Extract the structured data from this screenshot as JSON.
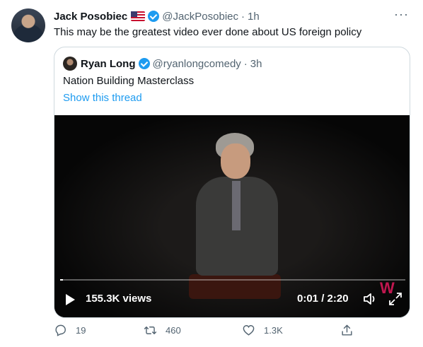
{
  "tweet": {
    "author_name": "Jack Posobiec",
    "author_flag": "🇺🇸",
    "author_handle": "@JackPosobiec",
    "time": "1h",
    "separator": "·",
    "more": "···",
    "text": "This may be the greatest video ever done about US foreign policy"
  },
  "quoted": {
    "author_name": "Ryan Long",
    "author_handle": "@ryanlongcomedy",
    "time": "3h",
    "separator": "·",
    "text": "Nation Building Masterclass",
    "thread_link": "Show this thread"
  },
  "video": {
    "views": "155.3K views",
    "time": "0:01 / 2:20",
    "progress": 0.009,
    "watermark": "W"
  },
  "actions": {
    "reply_count": "19",
    "retweet_count": "460",
    "like_count": "1.3K",
    "share_label": ""
  },
  "colors": {
    "accent": "#1d9bf0",
    "muted": "#536471",
    "border": "#cfd9de"
  },
  "icons": [
    "verified-badge-icon",
    "more-icon",
    "play-icon",
    "volume-icon",
    "expand-icon",
    "reply-icon",
    "retweet-icon",
    "like-icon",
    "share-icon"
  ]
}
